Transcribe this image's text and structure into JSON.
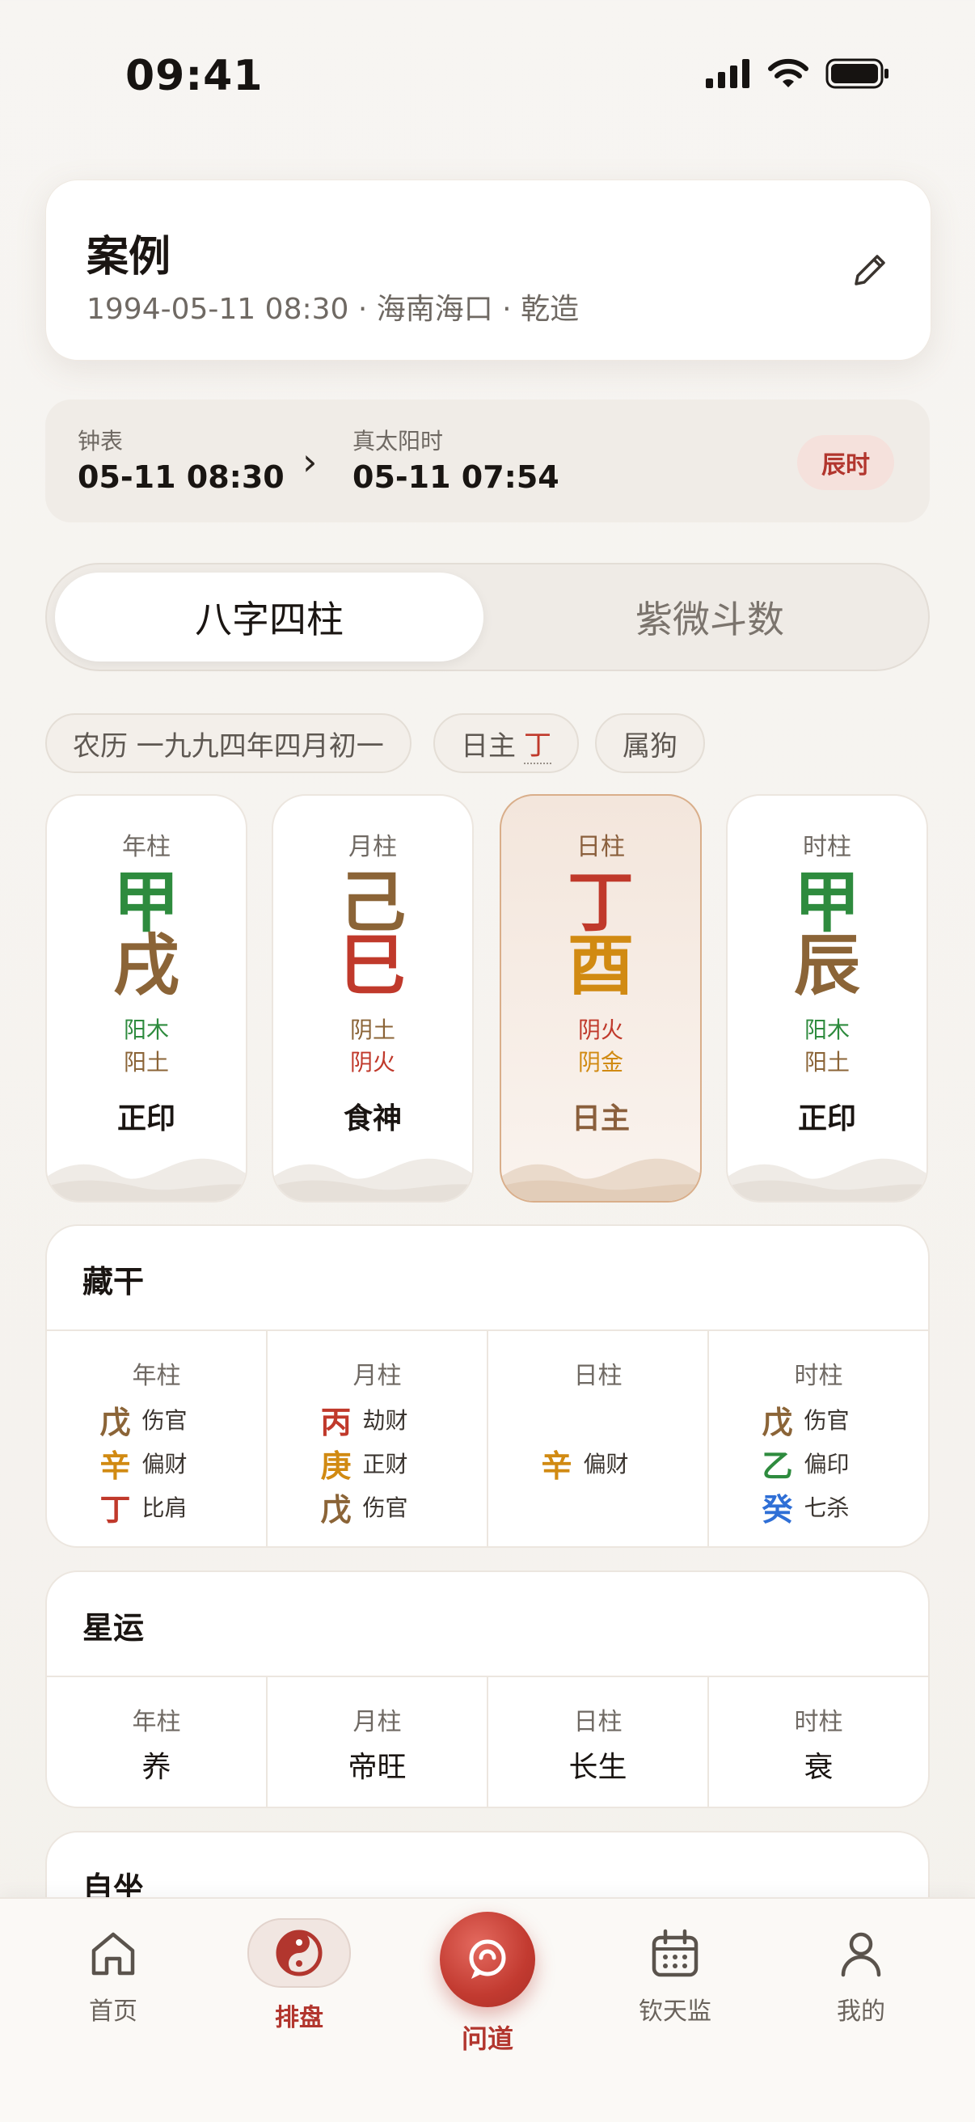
{
  "status_bar": {
    "time": "09:41"
  },
  "case": {
    "title": "案例",
    "subtitle": "1994-05-11 08:30 · 海南海口 · 乾造"
  },
  "time_conversion": {
    "clock_label": "钟表",
    "clock_value": "05-11 08:30",
    "solar_label": "真太阳时",
    "solar_value": "05-11 07:54",
    "shichen": "辰时"
  },
  "tabs": [
    {
      "label": "八字四柱",
      "active": true
    },
    {
      "label": "紫微斗数",
      "active": false
    }
  ],
  "chips": {
    "lunar": "农历 一九九四年四月初一",
    "day_master_label": "日主",
    "day_master_char": "丁",
    "zodiac": "属狗"
  },
  "pillars": [
    {
      "label": "年柱",
      "stem": "甲",
      "stem_color": "#2e8b3e",
      "branch": "戌",
      "branch_color": "#8b6437",
      "el1": "阳木",
      "el1_color": "#2e8b3e",
      "el2": "阳土",
      "el2_color": "#8b6437",
      "god": "正印"
    },
    {
      "label": "月柱",
      "stem": "己",
      "stem_color": "#8b6437",
      "branch": "巳",
      "branch_color": "#c0392b",
      "el1": "阴土",
      "el1_color": "#8b6437",
      "el2": "阴火",
      "el2_color": "#c0392b",
      "god": "食神"
    },
    {
      "label": "日柱",
      "stem": "丁",
      "stem_color": "#c0392b",
      "branch": "酉",
      "branch_color": "#d18a12",
      "el1": "阴火",
      "el1_color": "#c0392b",
      "el2": "阴金",
      "el2_color": "#d18a12",
      "god": "日主"
    },
    {
      "label": "时柱",
      "stem": "甲",
      "stem_color": "#2e8b3e",
      "branch": "辰",
      "branch_color": "#8b6437",
      "el1": "阳木",
      "el1_color": "#2e8b3e",
      "el2": "阳土",
      "el2_color": "#8b6437",
      "god": "正印"
    }
  ],
  "hidden_stems": {
    "title": "藏干",
    "columns": [
      {
        "label": "年柱",
        "items": [
          {
            "char": "戊",
            "color": "#8b6437",
            "god": "伤官"
          },
          {
            "char": "辛",
            "color": "#d18a12",
            "god": "偏财"
          },
          {
            "char": "丁",
            "color": "#c0392b",
            "god": "比肩"
          }
        ]
      },
      {
        "label": "月柱",
        "items": [
          {
            "char": "丙",
            "color": "#c0392b",
            "god": "劫财"
          },
          {
            "char": "庚",
            "color": "#d18a12",
            "god": "正财"
          },
          {
            "char": "戊",
            "color": "#8b6437",
            "god": "伤官"
          }
        ]
      },
      {
        "label": "日柱",
        "items": [
          {
            "char": "辛",
            "color": "#d18a12",
            "god": "偏财"
          }
        ]
      },
      {
        "label": "时柱",
        "items": [
          {
            "char": "戊",
            "color": "#8b6437",
            "god": "伤官"
          },
          {
            "char": "乙",
            "color": "#2e8b3e",
            "god": "偏印"
          },
          {
            "char": "癸",
            "color": "#2f6fd6",
            "god": "七杀"
          }
        ]
      }
    ]
  },
  "star_fortune": {
    "title": "星运",
    "columns": [
      {
        "label": "年柱",
        "value": "养"
      },
      {
        "label": "月柱",
        "value": "帝旺"
      },
      {
        "label": "日柱",
        "value": "长生"
      },
      {
        "label": "时柱",
        "value": "衰"
      }
    ]
  },
  "self_seat": {
    "title": "自坐"
  },
  "nav": {
    "items": [
      {
        "label": "首页",
        "icon": "home-icon",
        "active": false
      },
      {
        "label": "排盘",
        "icon": "yin-yang-icon",
        "active": true
      },
      {
        "label": "问道",
        "icon": "chat-icon",
        "active": false
      },
      {
        "label": "钦天监",
        "icon": "calendar-icon",
        "active": false
      },
      {
        "label": "我的",
        "icon": "user-icon",
        "active": false
      }
    ],
    "accent_color": "#b2362e"
  }
}
